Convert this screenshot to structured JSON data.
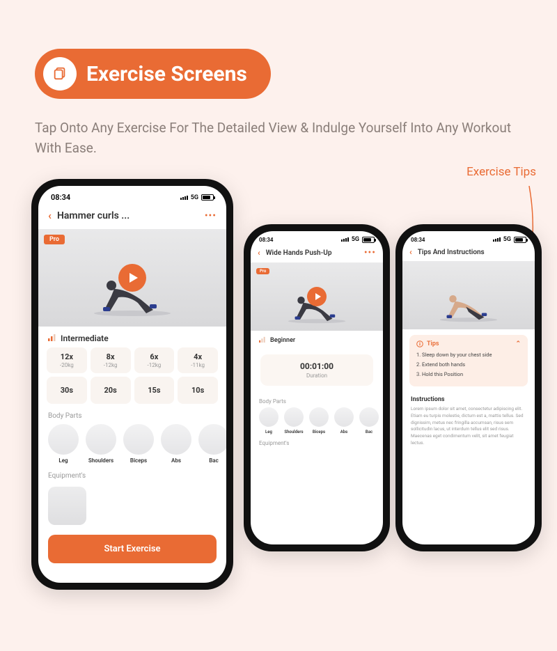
{
  "header": {
    "title": "Exercise Screens"
  },
  "subtitle": "Tap Onto Any Exercise For The Detailed View & Indulge Yourself Into Any Workout With Ease.",
  "callout": "Exercise Tips",
  "status": {
    "time": "08:34",
    "net": "5G"
  },
  "phone1": {
    "title": "Hammer curls ...",
    "pro": "Pro",
    "level": "Intermediate",
    "sets": [
      {
        "top": "12x",
        "sub": "-20kg"
      },
      {
        "top": "8x",
        "sub": "-12kg"
      },
      {
        "top": "6x",
        "sub": "-12kg"
      },
      {
        "top": "4x",
        "sub": "-11kg"
      }
    ],
    "rests": [
      "30s",
      "20s",
      "15s",
      "10s"
    ],
    "bodyparts_label": "Body Parts",
    "bodyparts": [
      "Leg",
      "Shoulders",
      "Biceps",
      "Abs",
      "Bac"
    ],
    "equip_label": "Equipment's",
    "cta": "Start Exercise"
  },
  "phone2": {
    "title": "Wide Hands Push-Up",
    "pro": "Pro",
    "level": "Beginner",
    "duration_value": "00:01:00",
    "duration_label": "Duration",
    "bodyparts_label": "Body Parts",
    "bodyparts": [
      "Leg",
      "Shoulders",
      "Biceps",
      "Abs",
      "Bac"
    ],
    "equip_label": "Equipment's"
  },
  "phone3": {
    "title": "Tips And Instructions",
    "tips_heading": "Tips",
    "tips": [
      "1. Sleep down by your chest side",
      "2. Extend both hands",
      "3. Hold this Position"
    ],
    "instr_heading": "Instructions",
    "instr_body": "Lorem ipsum dolor sit amet, consectetur adipiscing elit. Etiam eu turpis molestie, dictum est a, mattis tellus. Sed dignissim, metus nec fringilla accumsan, risus sem sollicitudin lacus, ut interdum tellus elit sed risus. Maecenas eget condimentum velit, sit amet feugiat lectus."
  }
}
